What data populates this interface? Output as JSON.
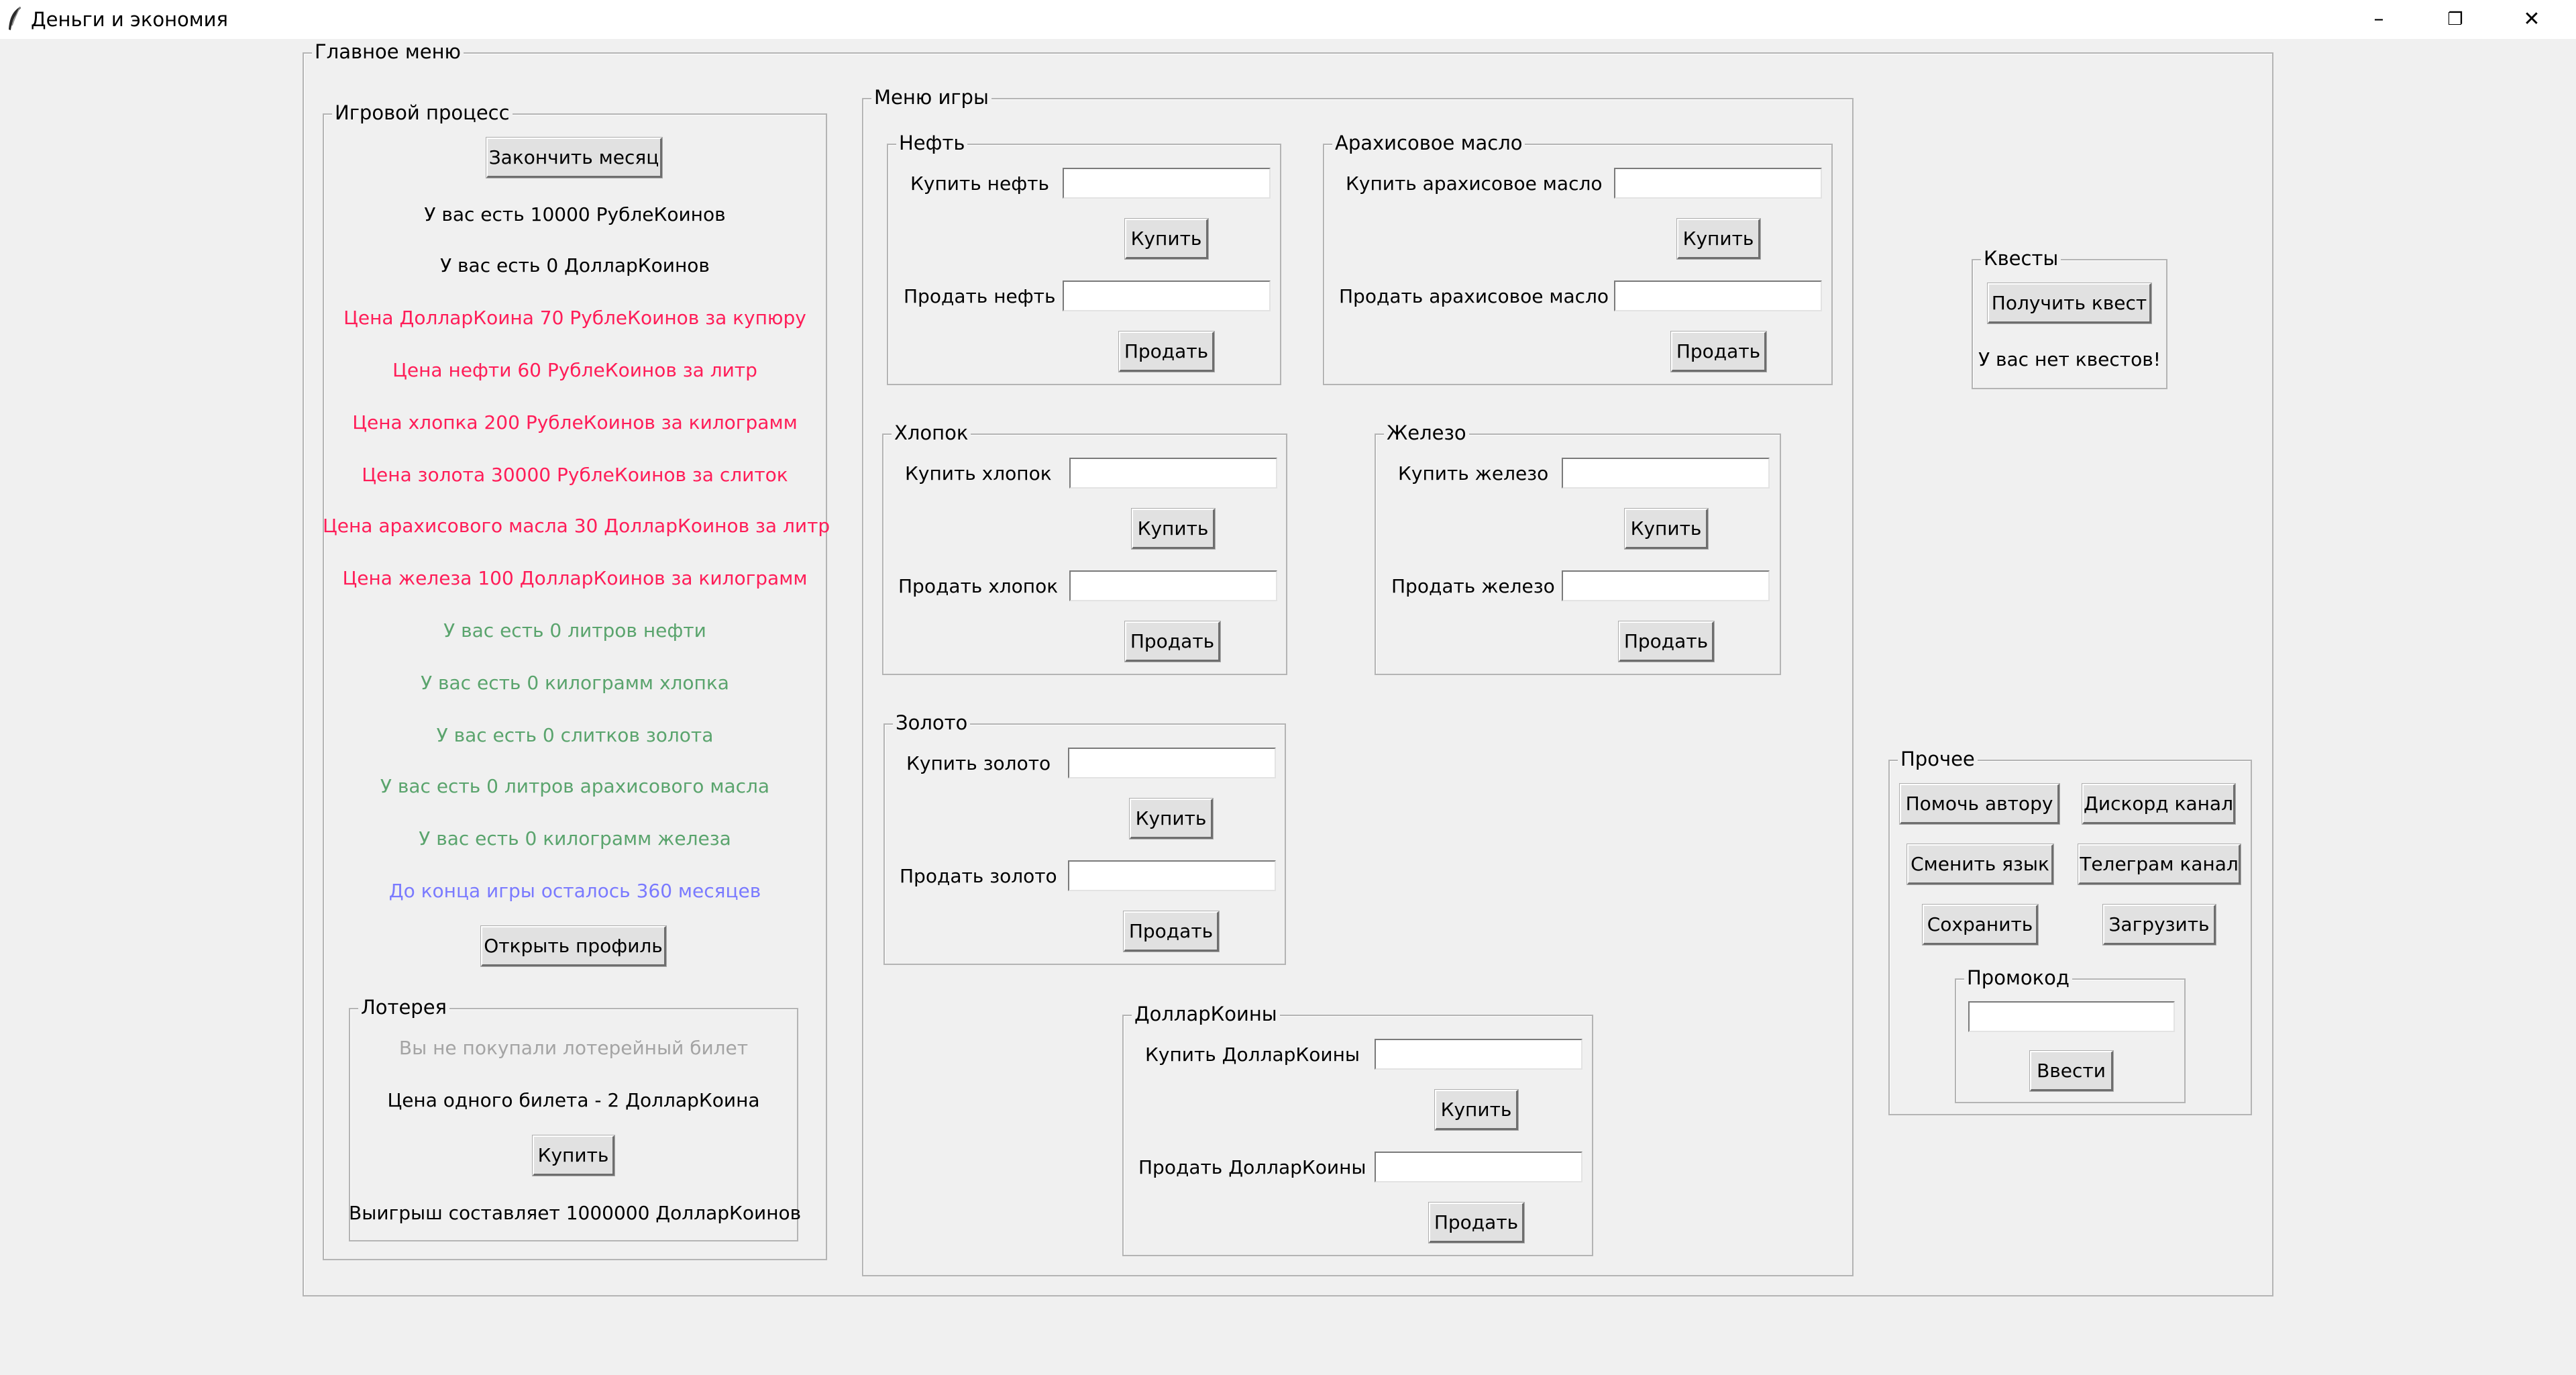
{
  "window": {
    "title": "Деньги и экономия",
    "minimize_label": "–",
    "maximize_label": "❐",
    "close_label": "✕"
  },
  "main_menu": {
    "legend": "Главное меню"
  },
  "game_process": {
    "legend": "Игровой процесс",
    "end_month_button": "Закончить месяц",
    "rubles_text": "У вас есть 10000 РублеКоинов",
    "dollars_text": "У вас есть 0 ДолларКоинов",
    "price_dollar": "Цена ДолларКоина 70 РублеКоинов за купюру",
    "price_oil": "Цена нефти 60 РублеКоинов за литр",
    "price_cotton": "Цена хлопка 200 РублеКоинов за килограмм",
    "price_gold": "Цена золота 30000 РублеКоинов за слиток",
    "price_peanut": "Цена арахисового масла 30 ДолларКоинов за литр",
    "price_iron": "Цена железа 100 ДолларКоинов за килограмм",
    "have_oil": "У вас есть 0 литров нефти",
    "have_cotton": "У вас есть 0 килограмм хлопка",
    "have_gold": "У вас есть 0 слитков золота",
    "have_peanut": "У вас есть 0 литров арахисового масла",
    "have_iron": "У вас есть 0 килограмм железа",
    "months_left": "До конца игры осталось 360 месяцев",
    "open_profile_button": "Открыть профиль"
  },
  "lottery": {
    "legend": "Лотерея",
    "status": "Вы не покупали лотерейный билет",
    "ticket_price": "Цена одного билета - 2 ДолларКоина",
    "buy_button": "Купить",
    "prize": "Выигрыш составляет 1000000 ДолларКоинов"
  },
  "game_menu": {
    "legend": "Меню игры",
    "oil": {
      "legend": "Нефть",
      "buy_label": "Купить нефть",
      "sell_label": "Продать нефть",
      "buy_button": "Купить",
      "sell_button": "Продать",
      "buy_value": "",
      "sell_value": ""
    },
    "peanut": {
      "legend": "Арахисовое масло",
      "buy_label": "Купить арахисовое масло",
      "sell_label": "Продать арахисовое масло",
      "buy_button": "Купить",
      "sell_button": "Продать",
      "buy_value": "",
      "sell_value": ""
    },
    "cotton": {
      "legend": "Хлопок",
      "buy_label": "Купить хлопок",
      "sell_label": "Продать хлопок",
      "buy_button": "Купить",
      "sell_button": "Продать",
      "buy_value": "",
      "sell_value": ""
    },
    "iron": {
      "legend": "Железо",
      "buy_label": "Купить железо",
      "sell_label": "Продать железо",
      "buy_button": "Купить",
      "sell_button": "Продать",
      "buy_value": "",
      "sell_value": ""
    },
    "gold": {
      "legend": "Золото",
      "buy_label": "Купить золото",
      "sell_label": "Продать золото",
      "buy_button": "Купить",
      "sell_button": "Продать",
      "buy_value": "",
      "sell_value": ""
    },
    "dollarcoins": {
      "legend": "ДолларКоины",
      "buy_label": "Купить ДолларКоины",
      "sell_label": "Продать ДолларКоины",
      "buy_button": "Купить",
      "sell_button": "Продать",
      "buy_value": "",
      "sell_value": ""
    }
  },
  "quests": {
    "legend": "Квесты",
    "get_quest_button": "Получить квест",
    "status": "У вас нет квестов!"
  },
  "other": {
    "legend": "Прочее",
    "help_author_button": "Помочь автору",
    "discord_button": "Дискорд канал",
    "change_language_button": "Сменить язык",
    "telegram_button": "Телеграм канал",
    "save_button": "Сохранить",
    "load_button": "Загрузить",
    "promo": {
      "legend": "Промокод",
      "value": "",
      "enter_button": "Ввести"
    }
  },
  "colors": {
    "price_text": "#ff1d58",
    "holdings_text": "#5aa46d",
    "months_text": "#7a7aff",
    "disabled_text": "#a4a4a4"
  }
}
